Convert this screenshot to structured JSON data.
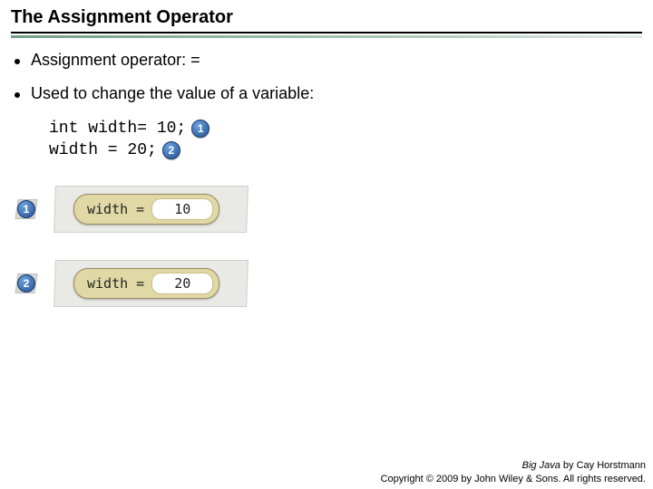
{
  "title": "The Assignment Operator",
  "bullets": [
    "Assignment operator: =",
    "Used to change the value of a variable:"
  ],
  "code": {
    "line1": "int width= 10;",
    "line2": "width = 20;",
    "marker1": "1",
    "marker2": "2"
  },
  "diagram": {
    "rows": [
      {
        "marker": "1",
        "label": "width =",
        "value": "10"
      },
      {
        "marker": "2",
        "label": "width =",
        "value": "20"
      }
    ]
  },
  "footer": {
    "book": "Big Java",
    "author": " by Cay Horstmann",
    "copyright": "Copyright © 2009 by John Wiley & Sons. All rights reserved."
  }
}
